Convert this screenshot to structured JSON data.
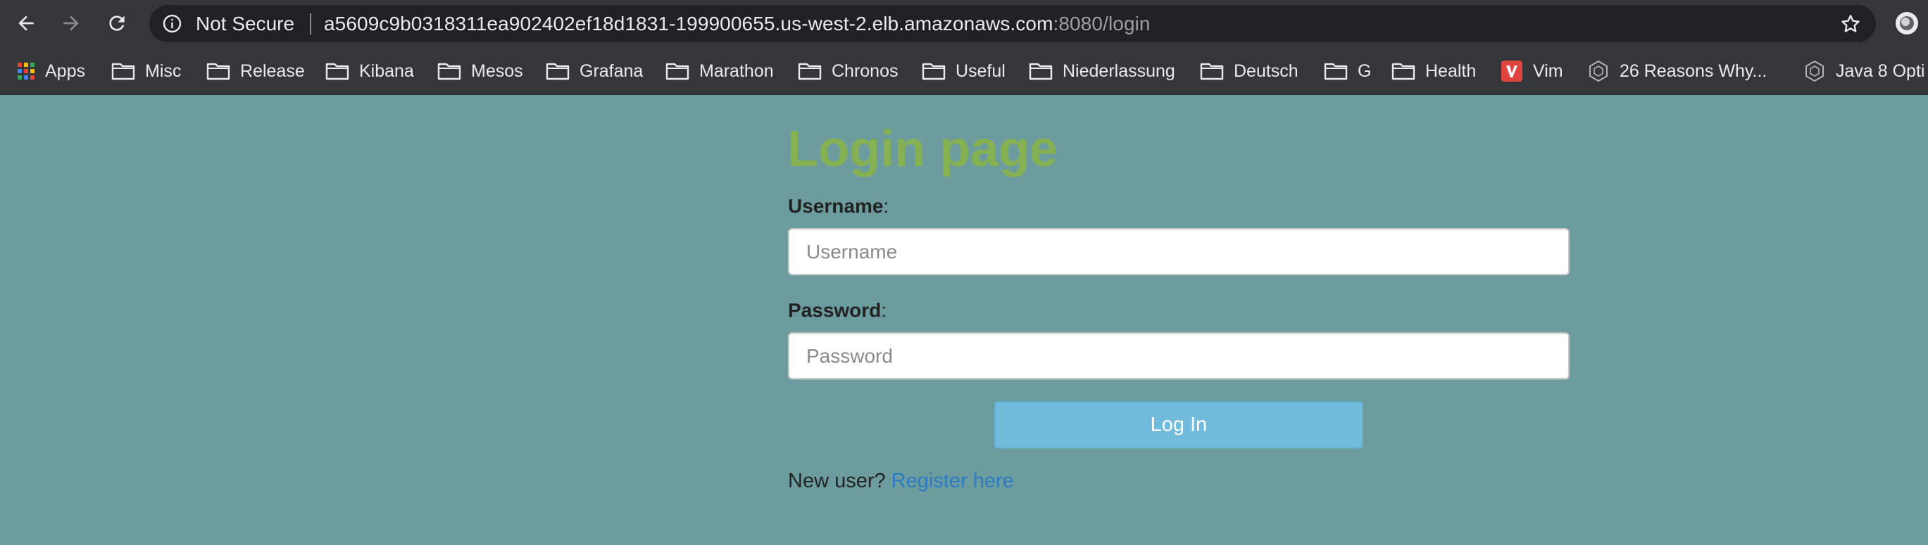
{
  "browser": {
    "security_label": "Not Secure",
    "url_host": "a5609c9b0318311ea902402ef18d1831-199900655.us-west-2.elb.amazonaws.com",
    "url_rest": ":8080/login"
  },
  "bookmarks": [
    {
      "label": "Apps",
      "icon": "apps-grid-icon"
    },
    {
      "label": "Misc",
      "icon": "folder-icon"
    },
    {
      "label": "Release",
      "icon": "folder-icon"
    },
    {
      "label": "Kibana",
      "icon": "folder-icon"
    },
    {
      "label": "Mesos",
      "icon": "folder-icon"
    },
    {
      "label": "Grafana",
      "icon": "folder-icon"
    },
    {
      "label": "Marathon",
      "icon": "folder-icon"
    },
    {
      "label": "Chronos",
      "icon": "folder-icon"
    },
    {
      "label": "Useful",
      "icon": "folder-icon"
    },
    {
      "label": "Niederlassung",
      "icon": "folder-icon"
    },
    {
      "label": "Deutsch",
      "icon": "folder-icon"
    },
    {
      "label": "G",
      "icon": "folder-icon"
    },
    {
      "label": "Health",
      "icon": "folder-icon"
    },
    {
      "label": "Vim",
      "icon": "vim-icon"
    },
    {
      "label": "26 Reasons Why...",
      "icon": "hexagon-icon"
    },
    {
      "label": "Java 8 Opti",
      "icon": "hexagon-icon"
    }
  ],
  "login": {
    "title": "Login page",
    "username_label": "Username",
    "username_placeholder": "Username",
    "password_label": "Password",
    "password_placeholder": "Password",
    "label_suffix": ":",
    "submit_label": "Log In",
    "new_user_text": "New user?",
    "register_link": "Register here"
  },
  "colors": {
    "page_background": "#6c9c9e",
    "title": "#86b152",
    "button": "#71bcdc",
    "link": "#2f7bc2"
  }
}
